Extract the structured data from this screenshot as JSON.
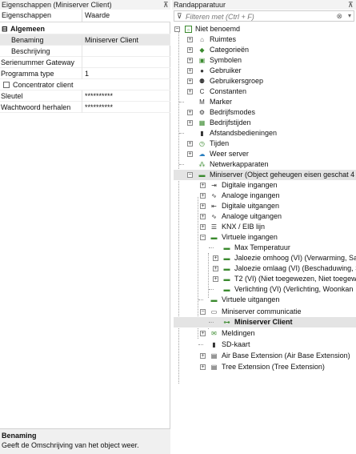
{
  "left": {
    "title": "Eigenschappen (Miniserver Client)",
    "pin": "⊼",
    "col1": "Eigenschappen",
    "col2": "Waarde",
    "rows": [
      {
        "key": "Algemeen",
        "value": "",
        "group": true
      },
      {
        "key": "Benaming",
        "value": "Miniserver Client"
      },
      {
        "key": "Beschrijving",
        "value": ""
      },
      {
        "key": "Serienummer Gateway",
        "value": ""
      },
      {
        "key": "Programma type",
        "value": "1"
      },
      {
        "key": "Concentrator client",
        "value": ""
      },
      {
        "key": "Sleutel",
        "value": "**********"
      },
      {
        "key": "Wachtwoord herhalen",
        "value": "**********"
      }
    ],
    "description_title": "Benaming",
    "description_text": "Geeft de Omschrijving van het object weer."
  },
  "right": {
    "title": "Randapparatuur",
    "pin": "⊼",
    "filter_placeholder": "Filteren met (Ctrl + F)",
    "tree": [
      {
        "label": "Niet benoemd",
        "icon": "project-icon"
      },
      {
        "label": "Ruimtes",
        "icon": "house-icon"
      },
      {
        "label": "Categorieën",
        "icon": "category-icon"
      },
      {
        "label": "Symbolen",
        "icon": "image-icon"
      },
      {
        "label": "Gebruiker",
        "icon": "user-icon"
      },
      {
        "label": "Gebruikersgroep",
        "icon": "users-icon"
      },
      {
        "label": "Constanten",
        "icon": "constant-icon"
      },
      {
        "label": "Marker",
        "icon": "marker-icon"
      },
      {
        "label": "Bedrijfsmodes",
        "icon": "gear-icon"
      },
      {
        "label": "Bedrijfstijden",
        "icon": "calendar-icon"
      },
      {
        "label": "Afstandsbedieningen",
        "icon": "remote-icon"
      },
      {
        "label": "Tijden",
        "icon": "clock-icon"
      },
      {
        "label": "Weer server",
        "icon": "weather-icon"
      },
      {
        "label": "Netwerkapparaten",
        "icon": "network-icon"
      },
      {
        "label": "Miniserver (Object geheugen eisen geschat 4",
        "icon": "miniserver-icon"
      },
      {
        "label": "Digitale ingangen",
        "icon": "digital-input-icon"
      },
      {
        "label": "Analoge ingangen",
        "icon": "analog-input-icon"
      },
      {
        "label": "Digitale uitgangen",
        "icon": "digital-output-icon"
      },
      {
        "label": "Analoge uitgangen",
        "icon": "analog-output-icon"
      },
      {
        "label": "KNX / EIB lijn",
        "icon": "knx-icon"
      },
      {
        "label": "Virtuele ingangen",
        "icon": "virtual-input-icon"
      },
      {
        "label": "Max Temperatuur",
        "icon": "virtual-item-icon"
      },
      {
        "label": "Jaloezie omhoog (VI) (Verwarming, Sa",
        "icon": "virtual-item-icon"
      },
      {
        "label": "Jaloezie omlaag (VI) (Beschaduwing, S",
        "icon": "virtual-item-icon"
      },
      {
        "label": "T2 (VI) (Niet toegewezen, Niet toegew",
        "icon": "virtual-item-icon"
      },
      {
        "label": "Verlichting (VI) (Verlichting, Woonkan",
        "icon": "virtual-item-icon"
      },
      {
        "label": "Virtuele uitgangen",
        "icon": "virtual-output-icon"
      },
      {
        "label": "Miniserver communicatie",
        "icon": "communication-icon"
      },
      {
        "label": "Miniserver Client",
        "icon": "client-icon"
      },
      {
        "label": "Meldingen",
        "icon": "notification-icon"
      },
      {
        "label": "SD-kaart",
        "icon": "sd-card-icon"
      },
      {
        "label": "Air Base Extension (Air Base Extension)",
        "icon": "extension-icon"
      },
      {
        "label": "Tree Extension (Tree Extension)",
        "icon": "extension-icon"
      }
    ]
  }
}
